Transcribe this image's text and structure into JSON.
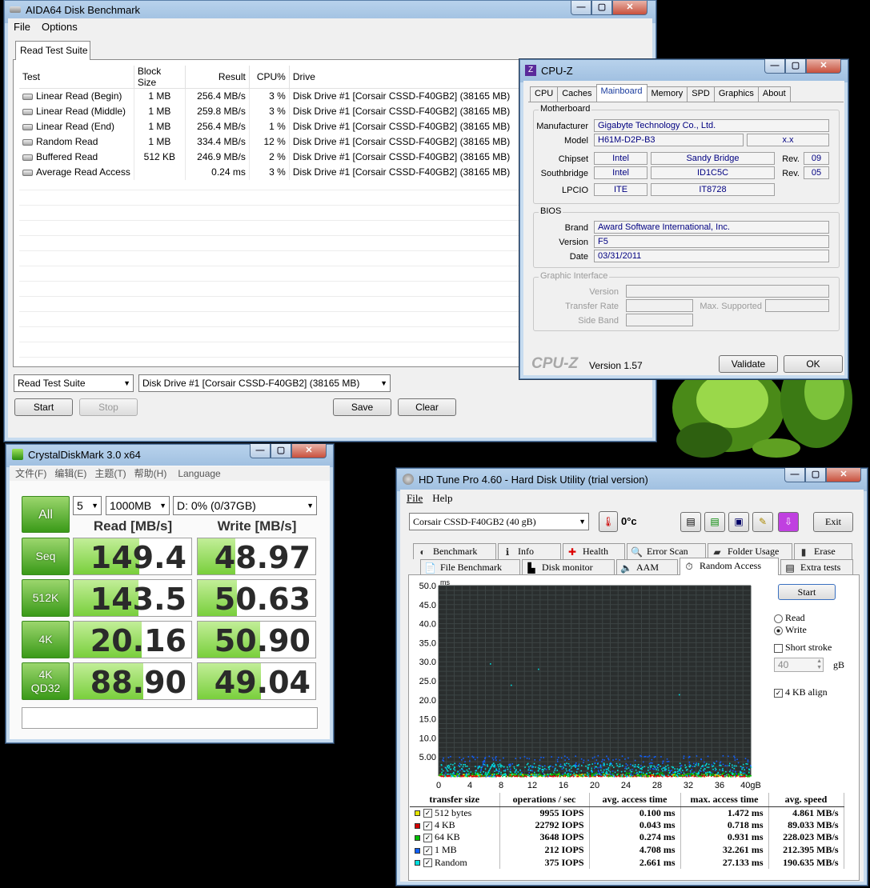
{
  "aida": {
    "title": "AIDA64 Disk Benchmark",
    "menu": [
      "File",
      "Options"
    ],
    "tab": "Read Test Suite",
    "columns": [
      "Test",
      "Block Size",
      "Result",
      "CPU%",
      "Drive"
    ],
    "rows": [
      {
        "test": "Linear Read (Begin)",
        "block": "1 MB",
        "result": "256.4 MB/s",
        "cpu": "3 %",
        "drive": "Disk Drive #1  [Corsair CSSD-F40GB2]  (38165 MB)"
      },
      {
        "test": "Linear Read (Middle)",
        "block": "1 MB",
        "result": "259.8 MB/s",
        "cpu": "3 %",
        "drive": "Disk Drive #1  [Corsair CSSD-F40GB2]  (38165 MB)"
      },
      {
        "test": "Linear Read (End)",
        "block": "1 MB",
        "result": "256.4 MB/s",
        "cpu": "1 %",
        "drive": "Disk Drive #1  [Corsair CSSD-F40GB2]  (38165 MB)"
      },
      {
        "test": "Random Read",
        "block": "1 MB",
        "result": "334.4 MB/s",
        "cpu": "12 %",
        "drive": "Disk Drive #1  [Corsair CSSD-F40GB2]  (38165 MB)"
      },
      {
        "test": "Buffered Read",
        "block": "512 KB",
        "result": "246.9 MB/s",
        "cpu": "2 %",
        "drive": "Disk Drive #1  [Corsair CSSD-F40GB2]  (38165 MB)"
      },
      {
        "test": "Average Read Access",
        "block": "",
        "result": "0.24 ms",
        "cpu": "3 %",
        "drive": "Disk Drive #1  [Corsair CSSD-F40GB2]  (38165 MB)"
      }
    ],
    "suite_select": "Read Test Suite",
    "drive_select": "Disk Drive #1  [Corsair CSSD-F40GB2]  (38165 MB)",
    "start": "Start",
    "stop": "Stop",
    "save": "Save",
    "clear": "Clear"
  },
  "cpuz": {
    "title": "CPU-Z",
    "tabs": [
      "CPU",
      "Caches",
      "Mainboard",
      "Memory",
      "SPD",
      "Graphics",
      "About"
    ],
    "motherboard_label": "Motherboard",
    "manufacturer_label": "Manufacturer",
    "manufacturer": "Gigabyte Technology Co., Ltd.",
    "model_label": "Model",
    "model": "H61M-D2P-B3",
    "model_rev": "x.x",
    "chipset_label": "Chipset",
    "chipset_vendor": "Intel",
    "chipset_name": "Sandy Bridge",
    "rev_label": "Rev.",
    "chipset_rev": "09",
    "southbridge_label": "Southbridge",
    "sb_vendor": "Intel",
    "sb_name": "ID1C5C",
    "sb_rev": "05",
    "lpcio_label": "LPCIO",
    "lpcio_vendor": "ITE",
    "lpcio_name": "IT8728",
    "bios_label": "BIOS",
    "brand_label": "Brand",
    "brand": "Award Software International, Inc.",
    "version_label": "Version",
    "version": "F5",
    "date_label": "Date",
    "date": "03/31/2011",
    "gi_label": "Graphic Interface",
    "gi_version": "Version",
    "gi_rate": "Transfer Rate",
    "gi_max": "Max. Supported",
    "gi_side": "Side Band",
    "logo": "CPU-Z",
    "app_version": "Version 1.57",
    "validate": "Validate",
    "ok": "OK"
  },
  "cdm": {
    "title": "CrystalDiskMark 3.0 x64",
    "menu": [
      "文件(F)",
      "编辑(E)",
      "主题(T)",
      "帮助(H)",
      "Language"
    ],
    "all": "All",
    "count": "5",
    "size": "1000MB",
    "drive": "D: 0% (0/37GB)",
    "read_header": "Read [MB/s]",
    "write_header": "Write [MB/s]",
    "rows": [
      {
        "label": "Seq",
        "read": "149.4",
        "write": "48.97",
        "read_frac": 0.56,
        "write_frac": 0.32
      },
      {
        "label": "512K",
        "read": "143.5",
        "write": "50.63",
        "read_frac": 0.55,
        "write_frac": 0.33
      },
      {
        "label": "4K",
        "read": "20.16",
        "write": "50.90",
        "read_frac": 0.58,
        "write_frac": 0.53
      },
      {
        "label": "4K QD32",
        "read": "88.90",
        "write": "49.04",
        "read_frac": 0.59,
        "write_frac": 0.54
      }
    ]
  },
  "hdtune": {
    "title": "HD Tune Pro 4.60 - Hard Disk Utility (trial version)",
    "menu": [
      "File",
      "Help"
    ],
    "drive": "Corsair CSSD-F40GB2     (40 gB)",
    "temp": "0°c",
    "exit": "Exit",
    "tabs_row1": [
      "Benchmark",
      "Info",
      "Health",
      "Error Scan",
      "Folder Usage",
      "Erase"
    ],
    "tabs_row2": [
      "File Benchmark",
      "Disk monitor",
      "AAM",
      "Random Access",
      "Extra tests"
    ],
    "start": "Start",
    "read": "Read",
    "write": "Write",
    "short_stroke": "Short stroke",
    "stroke_value": "40",
    "stroke_unit": "gB",
    "align": "4 KB align",
    "y_unit": "ms",
    "y_ticks": [
      "50.0",
      "45.0",
      "40.0",
      "35.0",
      "30.0",
      "25.0",
      "20.0",
      "15.0",
      "10.0",
      "5.00"
    ],
    "x_ticks": [
      "0",
      "4",
      "8",
      "12",
      "16",
      "20",
      "24",
      "28",
      "32",
      "36",
      "40gB"
    ],
    "stats_headers": [
      "transfer size",
      "operations / sec",
      "avg. access time",
      "max. access time",
      "avg. speed"
    ],
    "stats": [
      {
        "size": "512 bytes",
        "ops": "9955 IOPS",
        "avg": "0.100 ms",
        "max": "1.472 ms",
        "speed": "4.861 MB/s",
        "color": "#e6e600"
      },
      {
        "size": "4 KB",
        "ops": "22792 IOPS",
        "avg": "0.043 ms",
        "max": "0.718 ms",
        "speed": "89.033 MB/s",
        "color": "#d40000"
      },
      {
        "size": "64 KB",
        "ops": "3648 IOPS",
        "avg": "0.274 ms",
        "max": "0.931 ms",
        "speed": "228.023 MB/s",
        "color": "#00c000"
      },
      {
        "size": "1 MB",
        "ops": "212 IOPS",
        "avg": "4.708 ms",
        "max": "32.261 ms",
        "speed": "212.395 MB/s",
        "color": "#1060ff"
      },
      {
        "size": "Random",
        "ops": "375 IOPS",
        "avg": "2.661 ms",
        "max": "27.133 ms",
        "speed": "190.635 MB/s",
        "color": "#00e0e0"
      }
    ]
  }
}
